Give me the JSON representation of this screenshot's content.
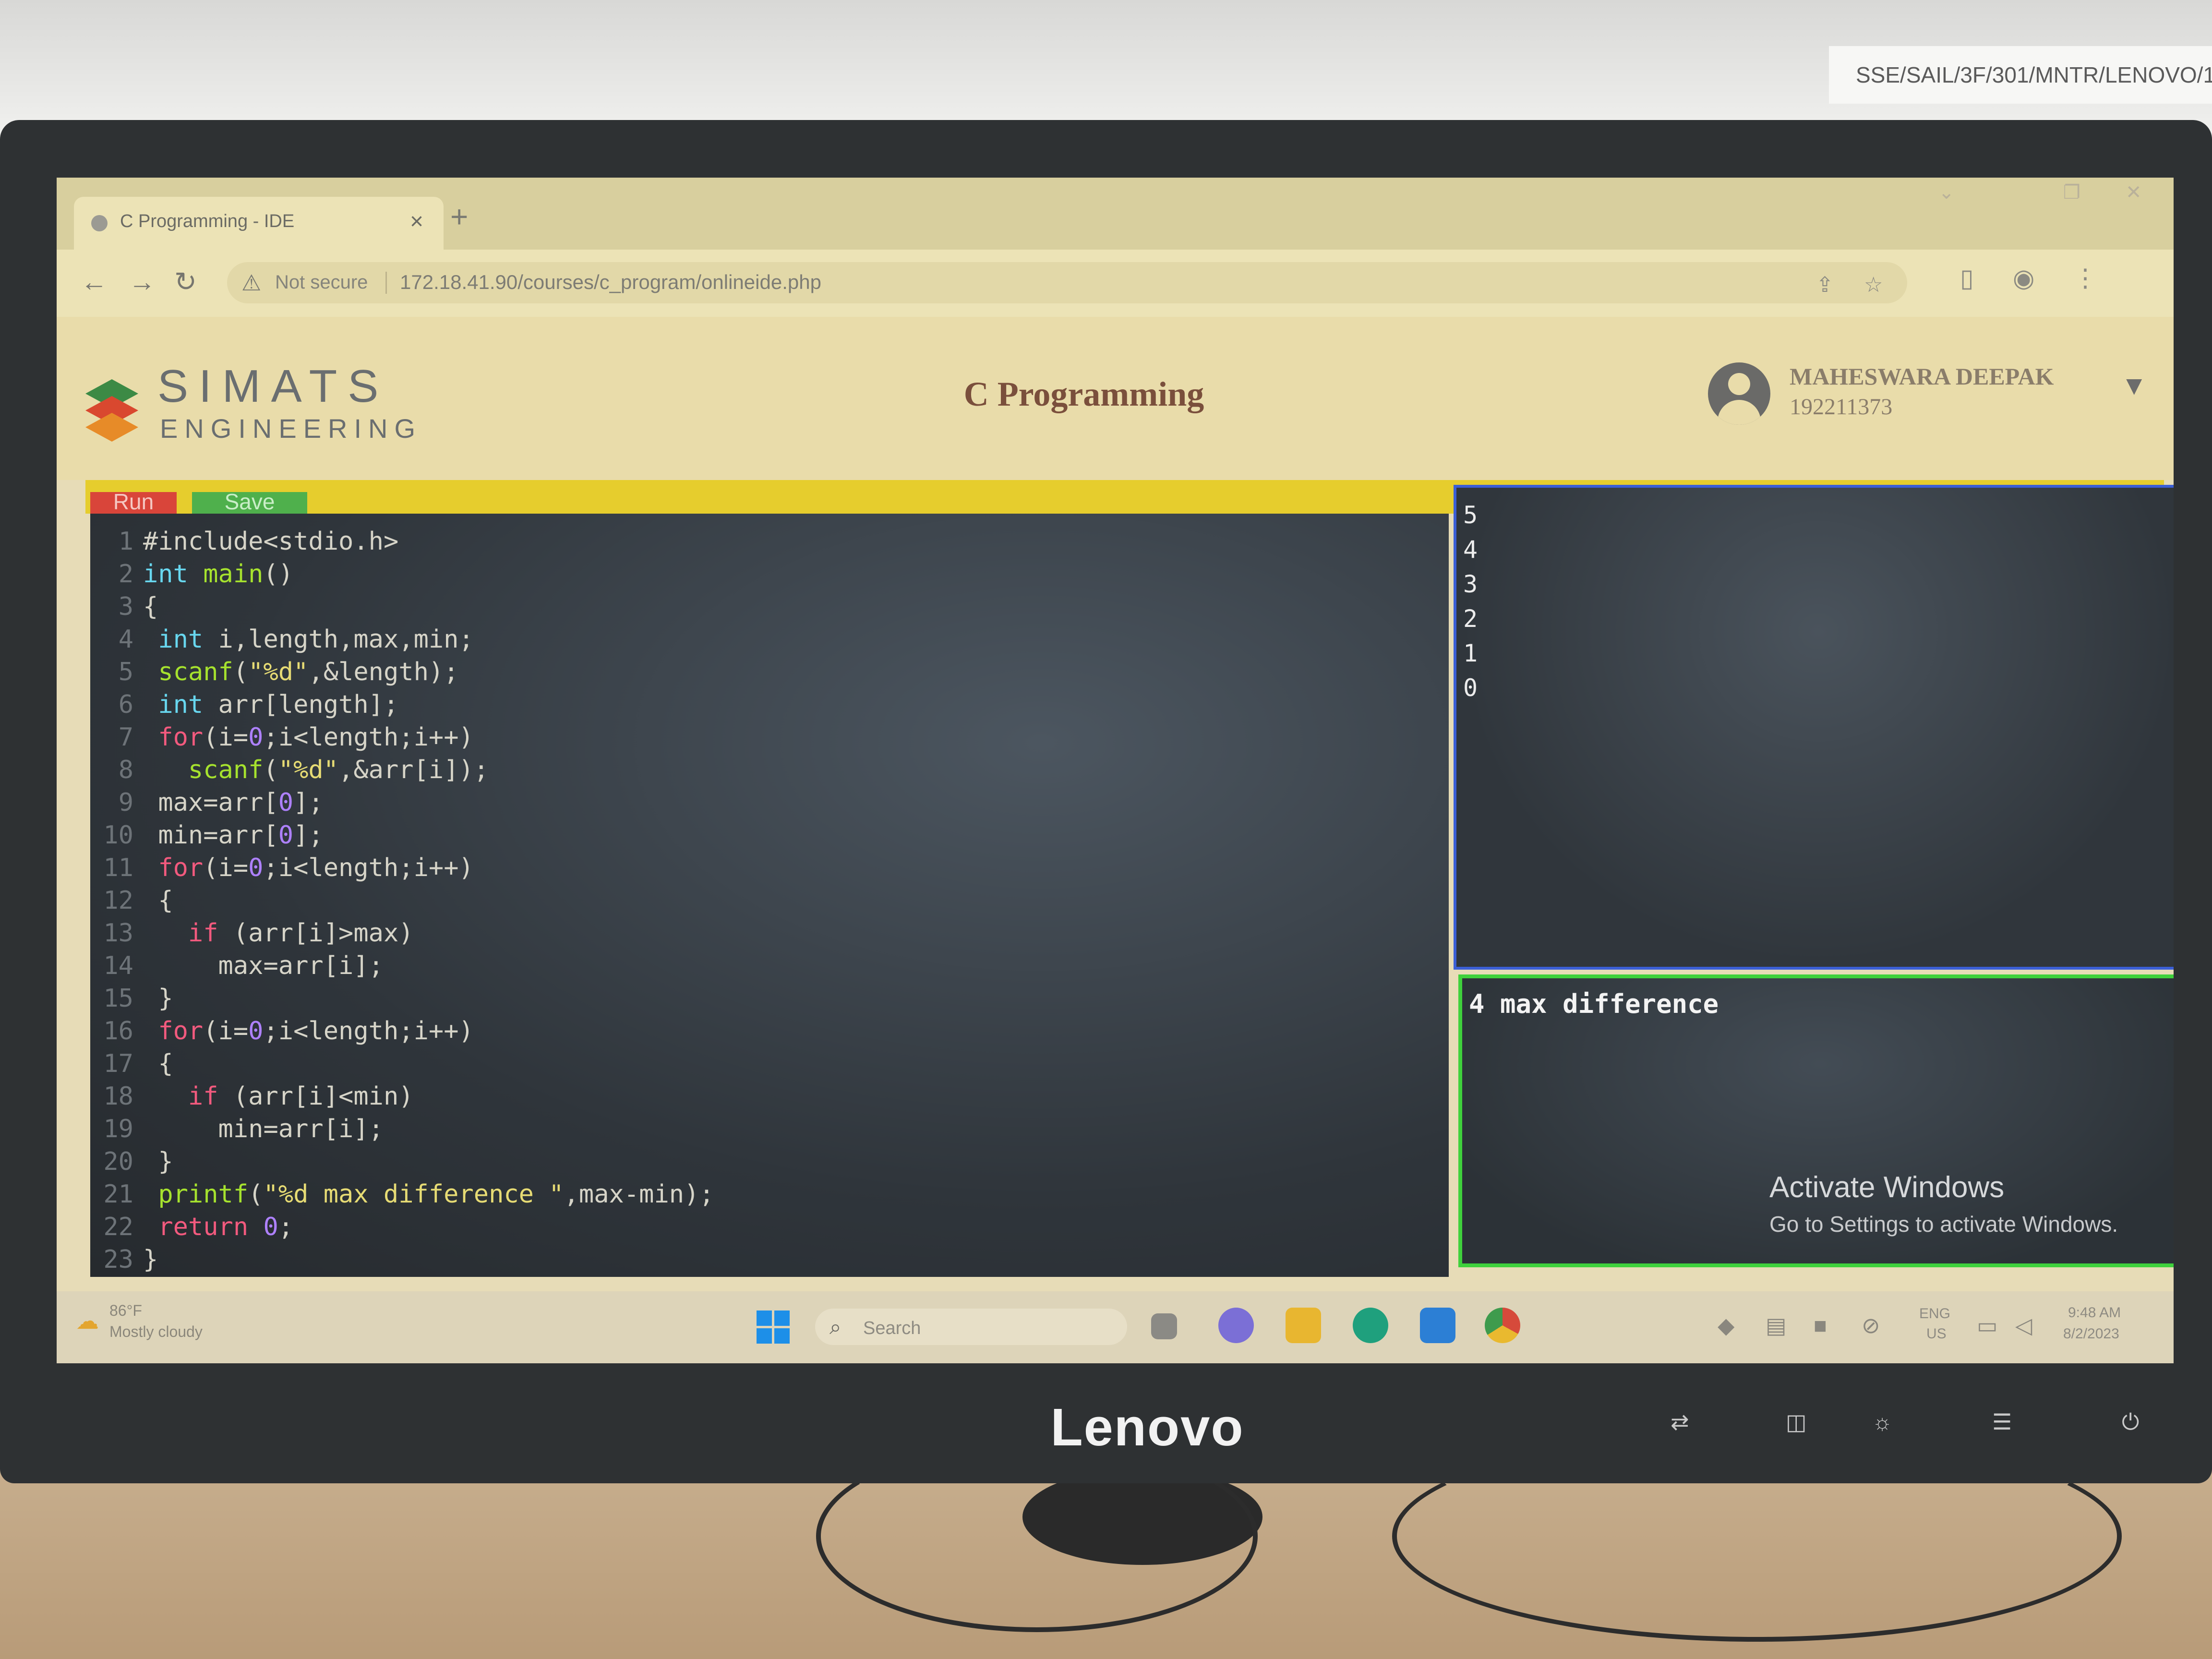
{
  "asset_label": "SSE/SAIL/3F/301/MNTR/LENOVO/1",
  "monitor": {
    "brand": "Lenovo"
  },
  "browser": {
    "tab_title": "C Programming - IDE",
    "tab_close": "×",
    "new_tab": "+",
    "security_label": "Not secure",
    "url": "172.18.41.90/courses/c_program/onlineide.php"
  },
  "header": {
    "logo_text": "SIMATS",
    "logo_sub": "ENGINEERING",
    "title": "C Programming",
    "user_name": "MAHESWARA DEEPAK",
    "user_id": "192211373"
  },
  "toolbar": {
    "run_label": "Run",
    "save_label": "Save"
  },
  "editor": {
    "lines": [
      {
        "n": "1",
        "code": "#include<stdio.h>"
      },
      {
        "n": "2",
        "code": "int main()"
      },
      {
        "n": "3",
        "code": "{"
      },
      {
        "n": "4",
        "code": " int i,length,max,min;"
      },
      {
        "n": "5",
        "code": " scanf(\"%d\",&length);"
      },
      {
        "n": "6",
        "code": " int arr[length];"
      },
      {
        "n": "7",
        "code": " for(i=0;i<length;i++)"
      },
      {
        "n": "8",
        "code": "   scanf(\"%d\",&arr[i]);"
      },
      {
        "n": "9",
        "code": " max=arr[0];"
      },
      {
        "n": "10",
        "code": " min=arr[0];"
      },
      {
        "n": "11",
        "code": " for(i=0;i<length;i++)"
      },
      {
        "n": "12",
        "code": " {"
      },
      {
        "n": "13",
        "code": "   if (arr[i]>max)"
      },
      {
        "n": "14",
        "code": "     max=arr[i];"
      },
      {
        "n": "15",
        "code": " }"
      },
      {
        "n": "16",
        "code": " for(i=0;i<length;i++)"
      },
      {
        "n": "17",
        "code": " {"
      },
      {
        "n": "18",
        "code": "   if (arr[i]<min)"
      },
      {
        "n": "19",
        "code": "     min=arr[i];"
      },
      {
        "n": "20",
        "code": " }"
      },
      {
        "n": "21",
        "code": " printf(\"%d max difference \",max-min);"
      },
      {
        "n": "22",
        "code": " return 0;"
      },
      {
        "n": "23",
        "code": "}"
      }
    ]
  },
  "input_panel": {
    "lines": [
      "5",
      "4",
      "3",
      "2",
      "1",
      "0"
    ]
  },
  "output_panel": {
    "text": "4 max difference"
  },
  "watermark": {
    "title": "Activate Windows",
    "subtitle": "Go to Settings to activate Windows."
  },
  "taskbar": {
    "weather_temp": "86°F",
    "weather_desc": "Mostly cloudy",
    "search_placeholder": "Search",
    "language": "ENG",
    "region": "US",
    "time": "9:48 AM",
    "date": "8/2/2023"
  },
  "colors": {
    "header_bg": "#e9dcaa",
    "accent_band": "#e6cd2d",
    "run_button": "#d9453a",
    "save_button": "#4fb04c",
    "input_panel_border": "#3b5fd6",
    "output_panel_border": "#3fd13c",
    "title_color": "#7a4f3c"
  }
}
